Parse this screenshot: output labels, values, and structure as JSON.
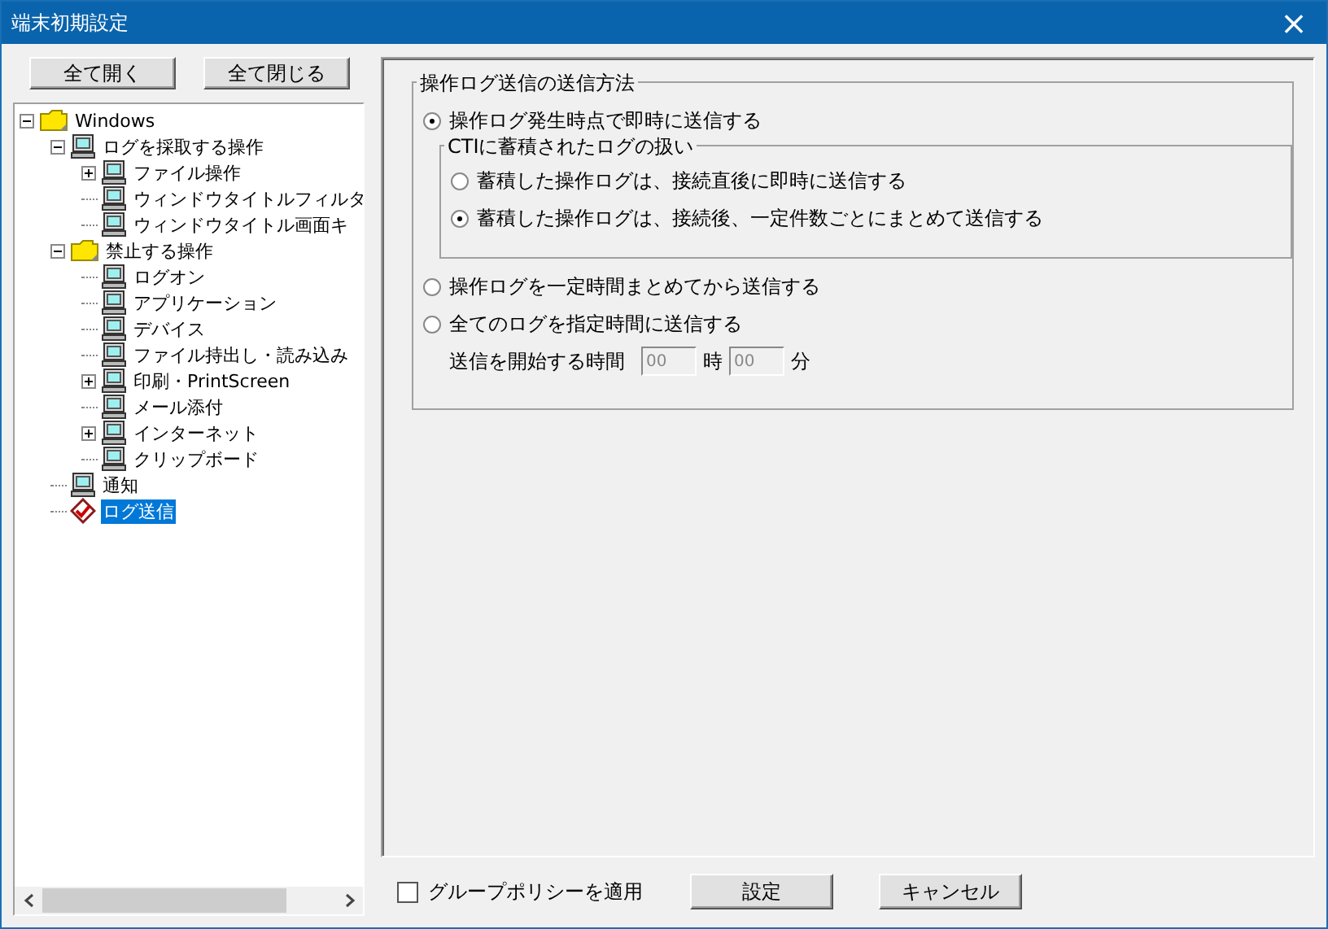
{
  "window": {
    "title": "端末初期設定",
    "close": "×"
  },
  "tree_buttons": [
    "全て開く",
    "全て閉じる"
  ],
  "tree": [
    {
      "label": "Windows",
      "kind": "folder",
      "expanded": true,
      "selected": false,
      "children": [
        {
          "label": "ログを採取する操作",
          "kind": "computer",
          "expanded": true,
          "selected": false,
          "children": [
            {
              "label": "ファイル操作",
              "kind": "computer",
              "expanded": false,
              "selected": false
            },
            {
              "label": "ウィンドウタイトルフィルタ",
              "kind": "computer",
              "selected": false
            },
            {
              "label": "ウィンドウタイトル画面キ",
              "kind": "computer",
              "selected": false
            }
          ]
        },
        {
          "label": "禁止する操作",
          "kind": "folder",
          "expanded": true,
          "selected": false,
          "children": [
            {
              "label": "ログオン",
              "kind": "computer",
              "selected": false
            },
            {
              "label": "アプリケーション",
              "kind": "computer",
              "selected": false
            },
            {
              "label": "デバイス",
              "kind": "computer",
              "selected": false
            },
            {
              "label": "ファイル持出し・読み込み",
              "kind": "computer",
              "selected": false
            },
            {
              "label": "印刷・PrintScreen",
              "kind": "computer",
              "expanded": false,
              "selected": false
            },
            {
              "label": "メール添付",
              "kind": "computer",
              "selected": false
            },
            {
              "label": "インターネット",
              "kind": "computer",
              "expanded": false,
              "selected": false
            },
            {
              "label": "クリップボード",
              "kind": "computer",
              "selected": false
            }
          ]
        },
        {
          "label": "通知",
          "kind": "computer",
          "selected": false
        },
        {
          "label": "ログ送信",
          "kind": "log",
          "selected": true
        }
      ]
    }
  ],
  "method": {
    "title": "操作ログ送信の送信方法",
    "items": [
      {
        "kind": "radio",
        "label": "操作ログ発生時点で即時に送信する",
        "selected": true
      },
      {
        "kind": "subgroup",
        "title": "CTIに蓄積されたログの扱い",
        "options": [
          {
            "label": "蓄積した操作ログは、接続直後に即時に送信する",
            "selected": false
          },
          {
            "label": "蓄積した操作ログは、接続後、一定件数ごとにまとめて送信する",
            "selected": true
          }
        ]
      },
      {
        "kind": "radio",
        "label": "操作ログを一定時間まとめてから送信する",
        "selected": false
      },
      {
        "kind": "radio",
        "label": "全てのログを指定時間に送信する",
        "selected": false
      },
      {
        "kind": "time",
        "label": "送信を開始する時間",
        "hour": "00",
        "hour_unit": "時",
        "minute": "00",
        "minute_unit": "分",
        "disabled": true
      }
    ]
  },
  "group_policy": {
    "label": "グループポリシーを適用",
    "checked": false
  },
  "buttons": [
    "設定",
    "キャンセル"
  ]
}
